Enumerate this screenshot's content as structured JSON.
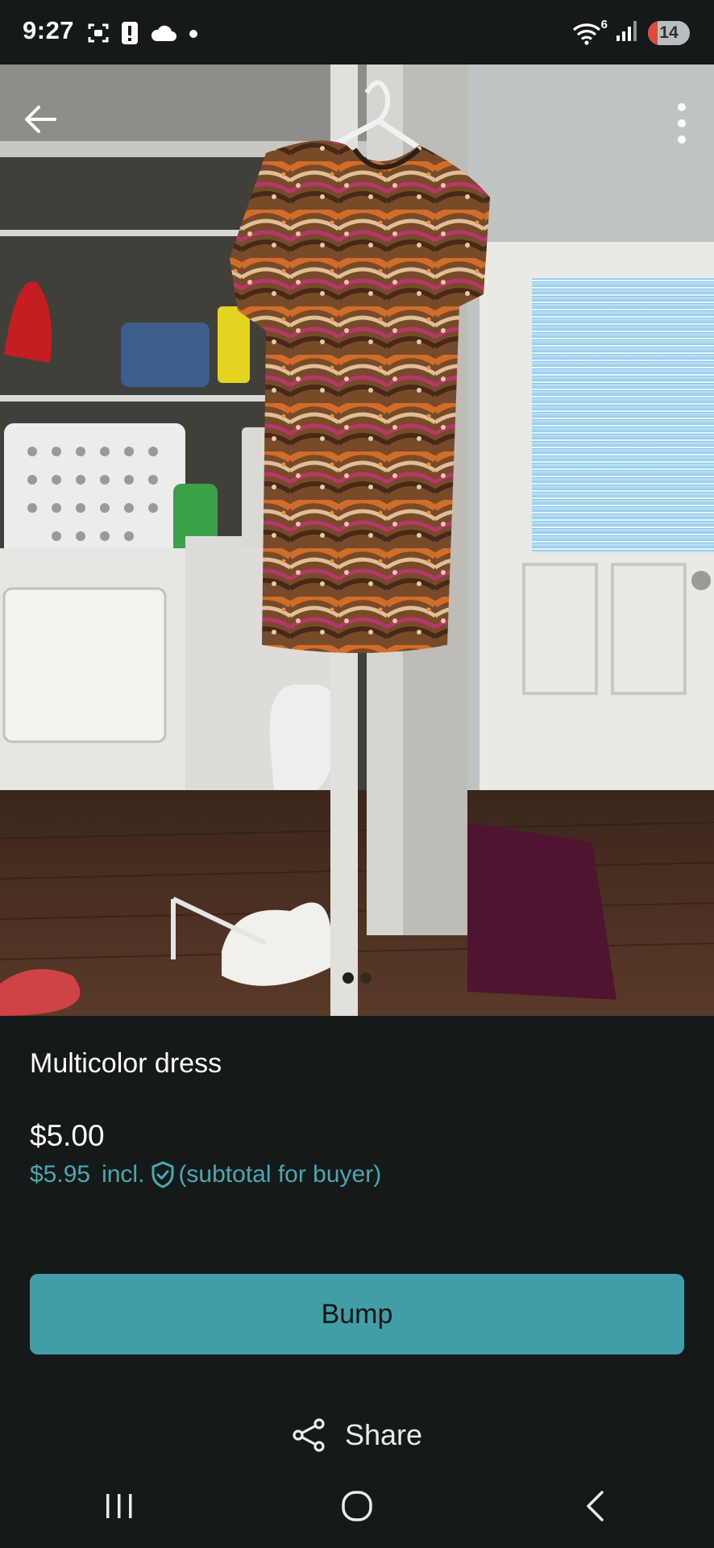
{
  "status_bar": {
    "time": "9:27",
    "icons": [
      "screenshot-icon",
      "alert-icon",
      "cloud-icon",
      "dot-icon"
    ],
    "wifi_label": "6",
    "battery_level": "14",
    "right_icons": [
      "wifi-icon",
      "signal-icon",
      "battery-icon"
    ]
  },
  "header": {
    "back_icon": "arrow-left-icon",
    "menu_icon": "more-vertical-icon"
  },
  "photo": {
    "page_count": 2,
    "active_index": 0
  },
  "listing": {
    "title": "Multicolor dress",
    "price": "$5.00",
    "buyer_price": "$5.95",
    "incl_label": "incl.",
    "subtotal_note": "(subtotal for buyer)"
  },
  "actions": {
    "bump_label": "Bump",
    "share_label": "Share"
  },
  "nav": {
    "recents_icon": "recents-icon",
    "home_icon": "home-icon",
    "back_icon": "back-chevron-icon"
  },
  "colors": {
    "background": "#16191a",
    "accent": "#419ea8",
    "accent_text": "#4aa8b3",
    "battery_low": "#e04a3a"
  }
}
